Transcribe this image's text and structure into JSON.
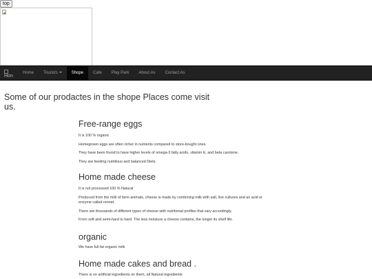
{
  "top_button": "top",
  "navbar": {
    "brand_alt": "Hon",
    "items": [
      {
        "label": "Home"
      },
      {
        "label": "Tourists"
      },
      {
        "label": "Shope"
      },
      {
        "label": "Cafe"
      },
      {
        "label": "Play Park"
      },
      {
        "label": "About As"
      },
      {
        "label": "Contact As"
      }
    ],
    "active": "Shope"
  },
  "intro": "Some of our prodactes in the shope Places come visit us.",
  "sections": [
    {
      "title": "Free-range eggs",
      "paragraphs": [
        "It is 100 % organic",
        "Homegrown eggs are often richer in nutrients compared to store-bought ones.",
        "They have been found to have higher levels of omega-3 fatty acids, vitamin E, and beta carotene.",
        "They are feeding nutritious and balanced Diets."
      ]
    },
    {
      "title": "Home made cheese",
      "paragraphs": [
        "It is not processed 100 % Natural",
        "Produced from the milk of farm animals, cheese is made by combining milk with salt, live cultures and an acid or enzyme called rennet.",
        "There are thousands of different types of cheese with nutritional profiles that vary accordingly.",
        "From soft and semi-hard to hard. The less moisture a cheese contains, the longer its shelf life."
      ]
    },
    {
      "title": "organic",
      "paragraphs": [
        "We have full fat organic milk"
      ]
    },
    {
      "title": "Home made cakes and bread .",
      "paragraphs": [
        "There is no artificial ingredients on them, all Natural ingredients"
      ]
    }
  ]
}
